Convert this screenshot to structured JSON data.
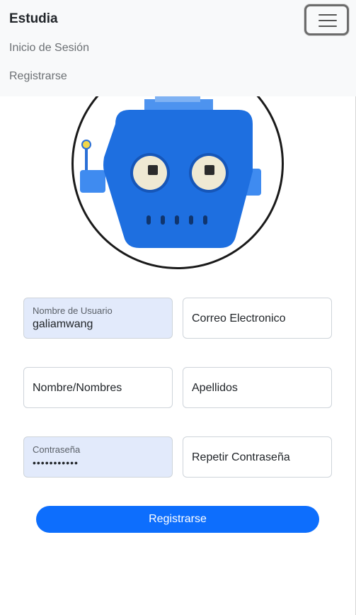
{
  "navbar": {
    "brand": "Estudia",
    "links": [
      "Inicio de Sesión",
      "Registrarse"
    ],
    "toggler_icon": "hamburger-icon"
  },
  "avatar": {
    "icon": "robot-icon",
    "colors": {
      "head": "#1e6fe0",
      "ears": "#3f8bf0",
      "top": "#4d93ef",
      "eyes": "#efe9d3",
      "border": "#1a1a1a"
    }
  },
  "form": {
    "username": {
      "label": "Nombre de Usuario",
      "value": "galiamwang"
    },
    "email": {
      "placeholder": "Correo Electronico"
    },
    "first_name": {
      "placeholder": "Nombre/Nombres"
    },
    "last_name": {
      "placeholder": "Apellidos"
    },
    "password": {
      "label": "Contraseña",
      "value": "•••••••••••"
    },
    "repeat_password": {
      "placeholder": "Repetir Contraseña"
    },
    "submit_label": "Registrarse"
  },
  "colors": {
    "primary": "#0d6efd",
    "autofill": "#e2eafb",
    "navbar_bg": "#f8f9fa"
  }
}
